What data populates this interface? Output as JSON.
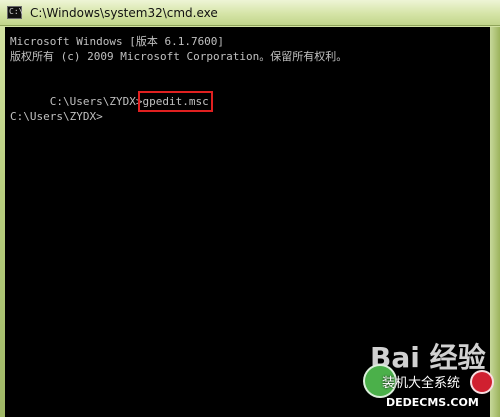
{
  "window": {
    "title": "C:\\Windows\\system32\\cmd.exe",
    "icon": "command-prompt-icon",
    "icon_text": "C:\\"
  },
  "console": {
    "lines": [
      "Microsoft Windows [版本 6.1.7600]",
      "版权所有 (c) 2009 Microsoft Corporation。保留所有权利。",
      "",
      "C:\\Users\\ZYDX>",
      "",
      "C:\\Users\\ZYDX>"
    ],
    "command": "gpedit.msc",
    "highlight_color": "#e02020",
    "background_color": "#000000",
    "text_color": "#c0c0c0"
  },
  "watermark": {
    "baidu_text": "Bai 经验",
    "chinese_text": "装机大全系统",
    "domain": "DEDECMS.COM"
  }
}
